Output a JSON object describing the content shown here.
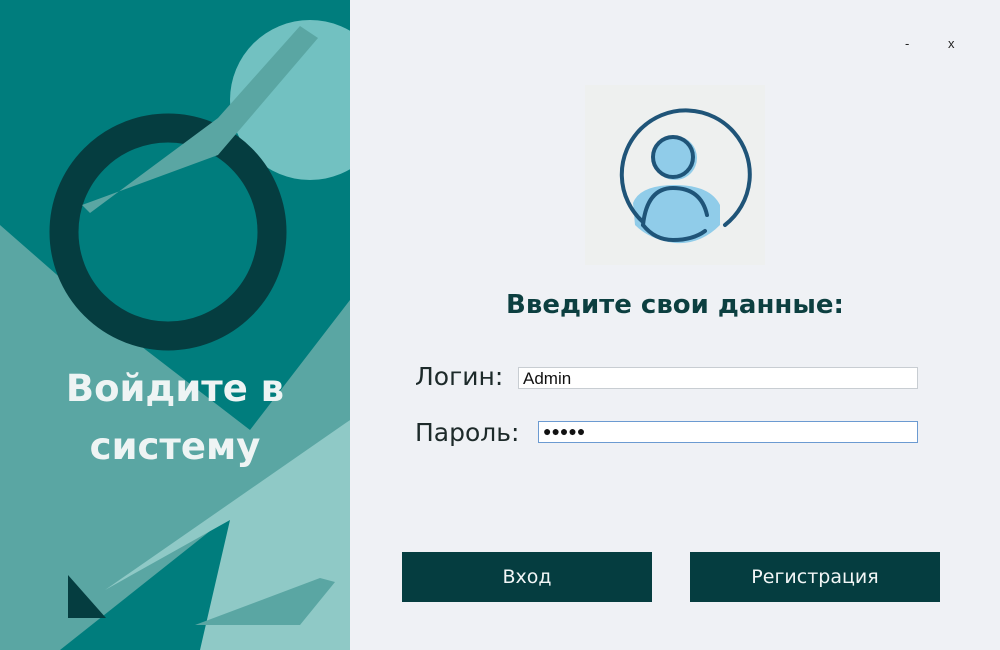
{
  "window": {
    "minimize_label": "-",
    "close_label": "x"
  },
  "left_panel": {
    "welcome_line1": "Войдите в",
    "welcome_line2": "систему"
  },
  "form": {
    "prompt": "Введите свои данные:",
    "login_label": "Логин:",
    "login_value": "Admin",
    "password_label": "Пароль:",
    "password_value": "●●●●●"
  },
  "buttons": {
    "login": "Вход",
    "register": "Регистрация"
  },
  "colors": {
    "teal": "#007d7d",
    "dark": "#053d40",
    "background": "#eff1f5"
  },
  "icons": {
    "avatar": "user-avatar-icon"
  }
}
